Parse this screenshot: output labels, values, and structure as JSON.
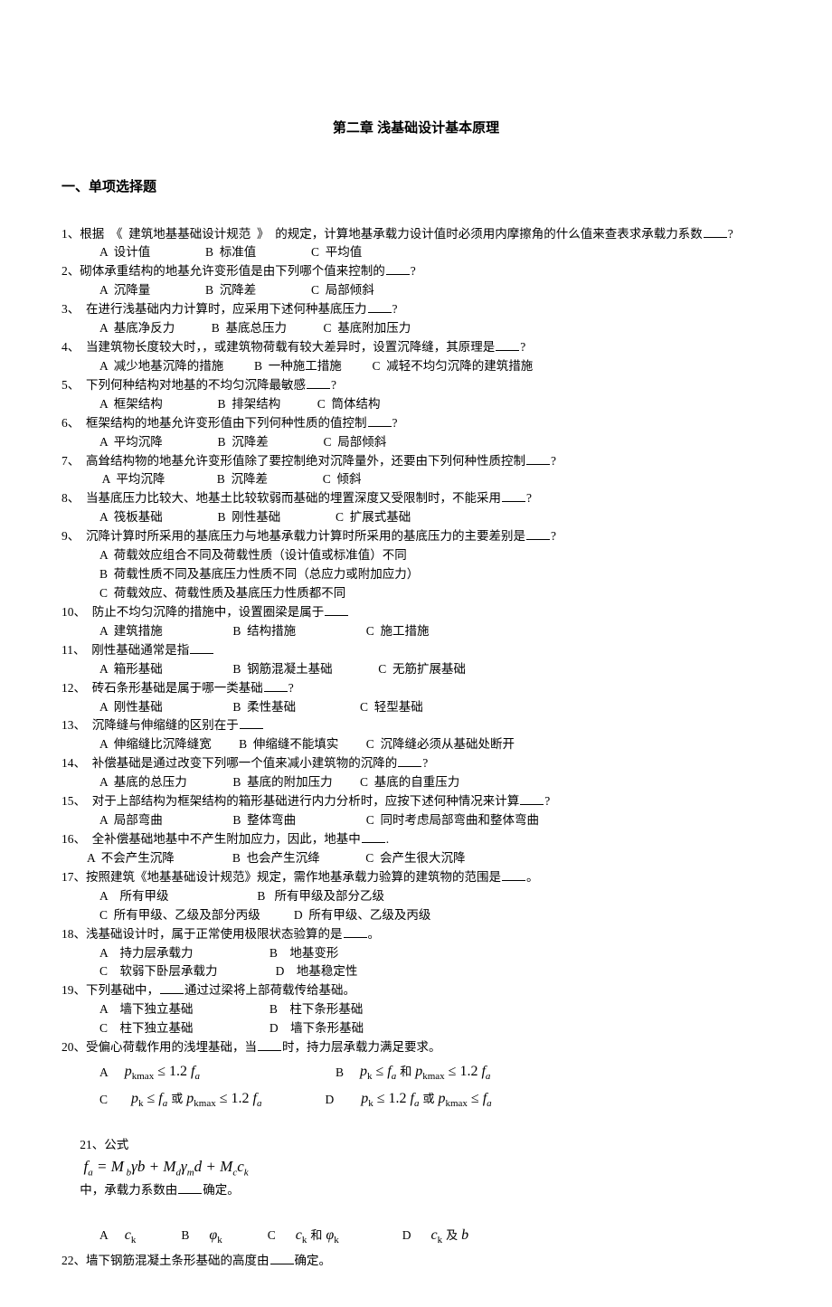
{
  "title": "第二章  浅基础设计基本原理",
  "section1_heading": "一、单项选择题",
  "qmark": "?",
  "period": "。",
  "q1": {
    "num": "1、",
    "text_a": "根据  《  建筑地基基础设计规范  》  的规定，计算地基承载力设计值时必须用内摩擦角的什么值来查表求承载力系数",
    "optA": "A  设计值",
    "optB": "B  标准值",
    "optC": "C  平均值"
  },
  "q2": {
    "num": "2、",
    "text_a": "砌体承重结构的地基允许变形值是由下列哪个值来控制的",
    "optA": "A  沉降量",
    "optB": "B  沉降差",
    "optC": "C  局部倾斜"
  },
  "q3": {
    "num": "3、",
    "text_a": "  在进行浅基础内力计算时，应采用下述何种基底压力",
    "optA": "A  基底净反力",
    "optB": "B  基底总压力",
    "optC": "C  基底附加压力"
  },
  "q4": {
    "num": "4、",
    "text_a": "  当建筑物长度较大时，，或建筑物荷载有较大差异时，设置沉降缝，其原理是",
    "optA": "A  减少地基沉降的措施",
    "optB": "B  一种施工措施",
    "optC": "C  减轻不均匀沉降的建筑措施"
  },
  "q5": {
    "num": "5、",
    "text_a": "  下列何种结构对地基的不均匀沉降最敏感",
    "optA": "A  框架结构",
    "optB": "B  排架结构",
    "optC": "C  筒体结构"
  },
  "q6": {
    "num": "6、",
    "text_a": "  框架结构的地基允许变形值由下列何种性质的值控制",
    "optA": "A  平均沉降",
    "optB": "B  沉降差",
    "optC": "C  局部倾斜"
  },
  "q7": {
    "num": "7、",
    "text_a": "  高耸结构物的地基允许变形值除了要控制绝对沉降量外，还要由下列何种性质控制",
    "optA": " A  平均沉降",
    "optB": "B  沉降差",
    "optC": "C  倾斜"
  },
  "q8": {
    "num": "8、",
    "text_a": "  当基底压力比较大、地基土比较软弱而基础的埋置深度又受限制时，不能采用",
    "optA": "A  筏板基础",
    "optB": "B  刚性基础",
    "optC": "C  扩展式基础"
  },
  "q9": {
    "num": "9、",
    "text_a": "  沉降计算时所采用的基底压力与地基承载力计算时所采用的基底压力的主要差别是",
    "lineA": "A  荷载效应组合不同及荷载性质（设计值或标准值）不同",
    "lineB": "B  荷载性质不同及基底压力性质不同（总应力或附加应力）",
    "lineC": "C  荷载效应、荷载性质及基底压力性质都不同"
  },
  "q10": {
    "num": "10、",
    "text_a": "  防止不均匀沉降的措施中，设置圈梁是属于",
    "optA": "A  建筑措施",
    "optB": "B  结构措施",
    "optC": "C  施工措施"
  },
  "q11": {
    "num": "11、",
    "text_a": "  刚性基础通常是指",
    "optA": "A  箱形基础",
    "optB": "B  钢筋混凝土基础",
    "optC": "C  无筋扩展基础"
  },
  "q12": {
    "num": "12、",
    "text_a": "  砖石条形基础是属于哪一类基础",
    "optA": "A  刚性基础",
    "optB": "B  柔性基础",
    "optC": "C  轻型基础"
  },
  "q13": {
    "num": "13、",
    "text_a": "  沉降缝与伸缩缝的区别在于",
    "optA": "A  伸缩缝比沉降缝宽",
    "optB": "B  伸缩缝不能填实",
    "optC": "C  沉降缝必须从基础处断开"
  },
  "q14": {
    "num": "14、",
    "text_a": "  补偿基础是通过改变下列哪一个值来减小建筑物的沉降的",
    "optA": "A  基底的总压力",
    "optB": "B  基底的附加压力",
    "optC": "C  基底的自重压力"
  },
  "q15": {
    "num": "15、",
    "text_a": "  对于上部结构为框架结构的箱形基础进行内力分析时，应按下述何种情况来计算",
    "optA": "A  局部弯曲",
    "optB": "B  整体弯曲",
    "optC": "C  同时考虑局部弯曲和整体弯曲"
  },
  "q16": {
    "num": "16、",
    "text_a": "  全补偿基础地基中不产生附加应力，因此，地基中",
    "tail": ".",
    "optA": "A  不会产生沉降",
    "optB": "B  也会产生沉绛",
    "optC": "C  会产生很大沉降"
  },
  "q17": {
    "num": "17、",
    "text_a": "按照建筑《地基基础设计规范》规定，需作地基承载力验算的建筑物的范围是",
    "optA": "A    所有甲级",
    "optB": "B   所有甲级及部分乙级",
    "optC": "C  所有甲级、乙级及部分丙级",
    "optD": "D  所有甲级、乙级及丙级"
  },
  "q18": {
    "num": "18、",
    "text_a": "浅基础设计时，属于正常使用极限状态验算的是",
    "optA": "A    持力层承载力",
    "optB": "B    地基变形",
    "optC": "C    软弱下卧层承载力",
    "optD": "D    地基稳定性"
  },
  "q19": {
    "num": "19、",
    "text_a": "下列基础中，",
    "text_b": "通过过梁将上部荷载传给基础。",
    "optA": "A    墙下独立基础",
    "optB": "B    柱下条形基础",
    "optC": "C    柱下独立基础",
    "optD": "D    墙下条形基础"
  },
  "q20": {
    "num": "20、",
    "text_a": "受偏心荷载作用的浅埋基础，当",
    "text_b": "时，持力层承载力满足要求。"
  },
  "q21": {
    "num": "21、",
    "text_a": "公式",
    "text_b": "中，承载力系数由",
    "text_c": "确定。"
  },
  "q22": {
    "num": "22、",
    "text_a": "墙下钢筋混凝土条形基础的高度由",
    "text_b": "确定。"
  },
  "formula_labels": {
    "A": "A",
    "B": "B",
    "C": "C",
    "D": "D"
  },
  "conj": {
    "and": "和",
    "or": "或",
    "and2": "及"
  }
}
